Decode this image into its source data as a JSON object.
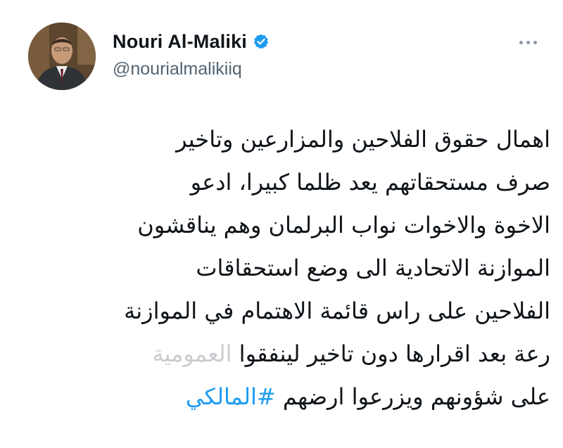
{
  "author": {
    "display_name": "Nouri Al-Maliki",
    "handle": "@nourialmalikiiq",
    "verified": true,
    "verified_color": "#1d9bf0"
  },
  "more_icon": "more-horizontal-icon",
  "tweet": {
    "lines": [
      "اهمال حقوق الفلاحين والمزارعين وتاخير",
      "صرف مستحقاتهم يعد ظلما كبيرا، ادعو",
      "الاخوة والاخوات نواب البرلمان وهم يناقشون",
      "الموازنة الاتحادية الى وضع استحقاقات",
      "الفلاحين على راس قائمة الاهتمام في الموازنة"
    ],
    "line6_visible": "رعة بعد اقرارها دون تاخير لينفقوا",
    "line6_faded": "العمومية",
    "line7_text": "على شؤونهم ويزرعوا ارضهم",
    "hashtag": "#المالكي",
    "hashtag_color": "#1d9bf0"
  }
}
